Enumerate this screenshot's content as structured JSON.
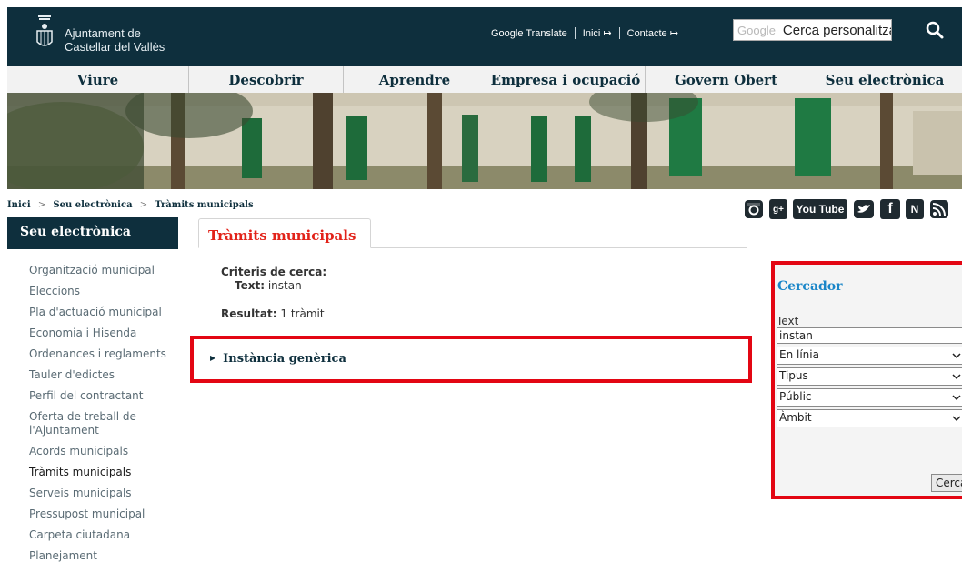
{
  "header": {
    "logo_line1": "Ajuntament de",
    "logo_line2": "Castellar del Vallès",
    "links": [
      "Google Translate",
      "Inici ↦",
      "Contacte ↦"
    ],
    "search_brand": "Google",
    "search_value": "Cerca personalitzada",
    "search_icon": "search-icon",
    "bg_color": "#0e2f3d"
  },
  "nav": {
    "items": [
      "Viure",
      "Descobrir",
      "Aprendre",
      "Empresa i ocupació",
      "Govern Obert",
      "Seu electrònica"
    ]
  },
  "breadcrumb": {
    "items": [
      "Inici",
      "Seu electrònica",
      "Tràmits municipals"
    ],
    "separator": ">"
  },
  "social": {
    "icons": [
      "instagram-icon",
      "google-plus-icon",
      "youtube-icon",
      "twitter-icon",
      "facebook-icon",
      "n-icon",
      "rss-icon"
    ],
    "youtube_label": "You Tube",
    "gplus_label": "g+",
    "n_label": "N",
    "fb_label": "f"
  },
  "sidebar": {
    "title": "Seu electrònica",
    "items": [
      "Organització municipal",
      "Eleccions",
      "Pla d'actuació municipal",
      "Economia i Hisenda",
      "Ordenances i reglaments",
      "Tauler d'edictes",
      "Perfil del contractant",
      "Oferta de treball de l'Ajuntament",
      "Acords municipals",
      "Tràmits municipals",
      "Serveis municipals",
      "Pressupost municipal",
      "Carpeta ciutadana",
      "Planejament"
    ],
    "active_index": 9
  },
  "content": {
    "tab_title": "Tràmits municipals",
    "criteria_label": "Criteris de cerca:",
    "criteria_text_label": "Text:",
    "criteria_text_value": "instan",
    "result_label": "Resultat:",
    "result_value": "1 tràmit",
    "result_item": "Instància genèrica",
    "highlight_color": "#e30613",
    "title_color": "#e2231a"
  },
  "cercador": {
    "title": "Cercador",
    "text_label": "Text",
    "text_value": "instan",
    "selects": [
      "En línia",
      "Tipus",
      "Públic",
      "Àmbit"
    ],
    "button_label": "Cercar",
    "title_color": "#1a86c8"
  }
}
